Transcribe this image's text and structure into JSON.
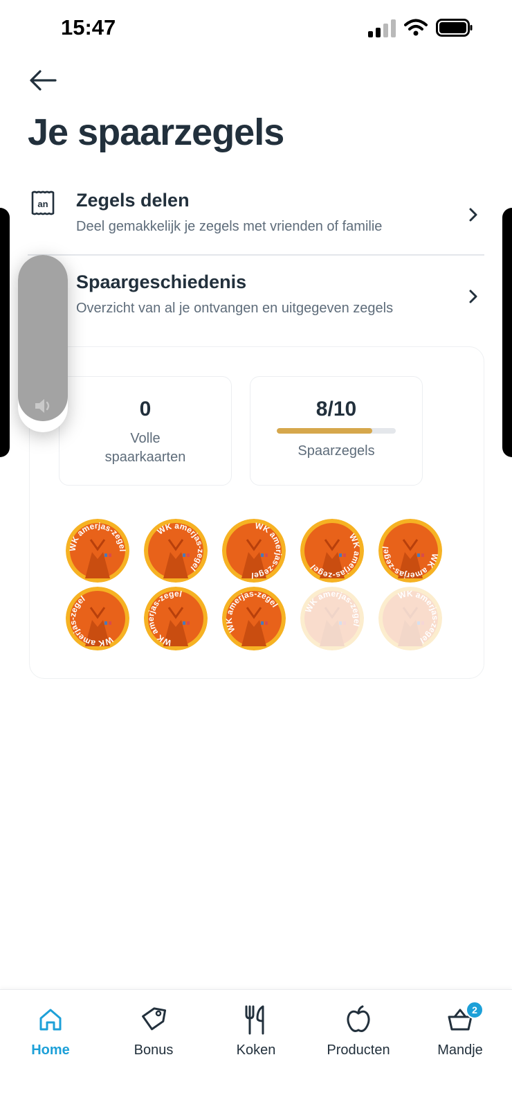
{
  "status_bar": {
    "time": "15:47"
  },
  "page": {
    "title": "Je spaarzegels"
  },
  "menu_rows": [
    {
      "title": "Zegels delen",
      "subtitle": "Deel gemakkelijk je zegels met vrienden of familie",
      "icon": "stamp-share-icon"
    },
    {
      "title": "Spaargeschiedenis",
      "subtitle": "Overzicht van al je ontvangen en uitgegeven zegels",
      "icon": "history-icon"
    }
  ],
  "summary": {
    "full_cards": {
      "value": "0",
      "label_line1": "Volle",
      "label_line2": "spaarkaarten"
    },
    "stamps": {
      "value": "8/10",
      "label": "Spaarzegels",
      "progress_fraction": 0.8
    }
  },
  "stamps": {
    "collected": 8,
    "total": 10,
    "stamp_text": "WK amerjas-zegel",
    "colors": {
      "orange": "#e8621a",
      "yellow": "#f6b223",
      "accent": "#1da0d8"
    }
  },
  "tabs": [
    {
      "label": "Home",
      "icon": "home-icon",
      "active": true
    },
    {
      "label": "Bonus",
      "icon": "tag-icon",
      "active": false
    },
    {
      "label": "Koken",
      "icon": "cutlery-icon",
      "active": false
    },
    {
      "label": "Producten",
      "icon": "apple-icon",
      "active": false
    },
    {
      "label": "Mandje",
      "icon": "basket-icon",
      "active": false,
      "badge": "2"
    }
  ]
}
